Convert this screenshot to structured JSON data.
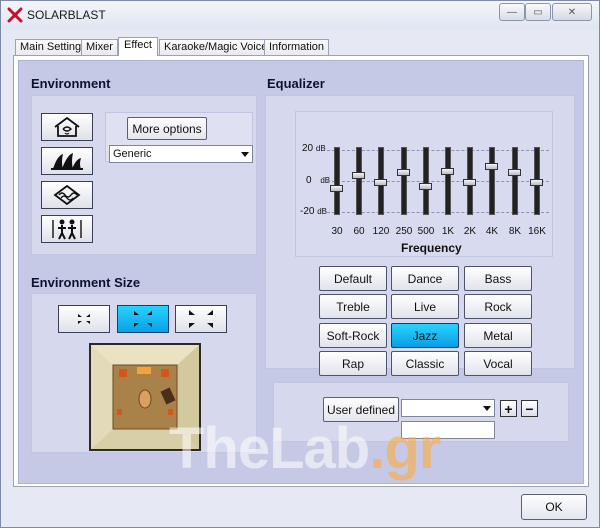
{
  "window": {
    "title": "SOLARBLAST",
    "minimize_glyph": "—",
    "maximize_glyph": "▭",
    "close_glyph": "✕"
  },
  "tabs": [
    {
      "label": "Main Setting",
      "active": false
    },
    {
      "label": "Mixer",
      "active": false
    },
    {
      "label": "Effect",
      "active": true
    },
    {
      "label": "Karaoke/Magic Voice",
      "active": false
    },
    {
      "label": "Information",
      "active": false
    }
  ],
  "environment": {
    "heading": "Environment",
    "icons": [
      "house-icon",
      "opera-house-icon",
      "wave-frame-icon",
      "people-icon"
    ],
    "more_options_label": "More options",
    "preset_selected": "Generic"
  },
  "environment_size": {
    "heading": "Environment Size",
    "options": [
      "small-room-icon",
      "medium-room-icon",
      "large-room-icon"
    ],
    "selected_index": 1
  },
  "equalizer": {
    "heading": "Equalizer",
    "db_top": "20",
    "db_mid": "0",
    "db_bottom": "-20",
    "db_unit": "dB",
    "frequency_title": "Frequency",
    "bands": [
      "30",
      "60",
      "120",
      "250",
      "500",
      "1K",
      "2K",
      "4K",
      "8K",
      "16K"
    ],
    "band_levels_db": [
      -5,
      3,
      -1,
      5,
      -4,
      6,
      -1,
      9,
      5,
      -1
    ],
    "presets": [
      [
        "Default",
        "Dance",
        "Bass"
      ],
      [
        "Treble",
        "Live",
        "Rock"
      ],
      [
        "Soft-Rock",
        "Jazz",
        "Metal"
      ],
      [
        "Rap",
        "Classic",
        "Vocal"
      ]
    ],
    "selected_preset": "Jazz",
    "user_defined_label": "User defined",
    "user_defined_value": "",
    "user_defined_name": "",
    "add_glyph": "+",
    "remove_glyph": "−"
  },
  "watermark": {
    "part1": "TheLab",
    "part2": ".gr"
  },
  "footer": {
    "ok_label": "OK"
  },
  "colors": {
    "panel_bg": "#c6c9e5",
    "selected_blue": "#0aa0e6"
  }
}
